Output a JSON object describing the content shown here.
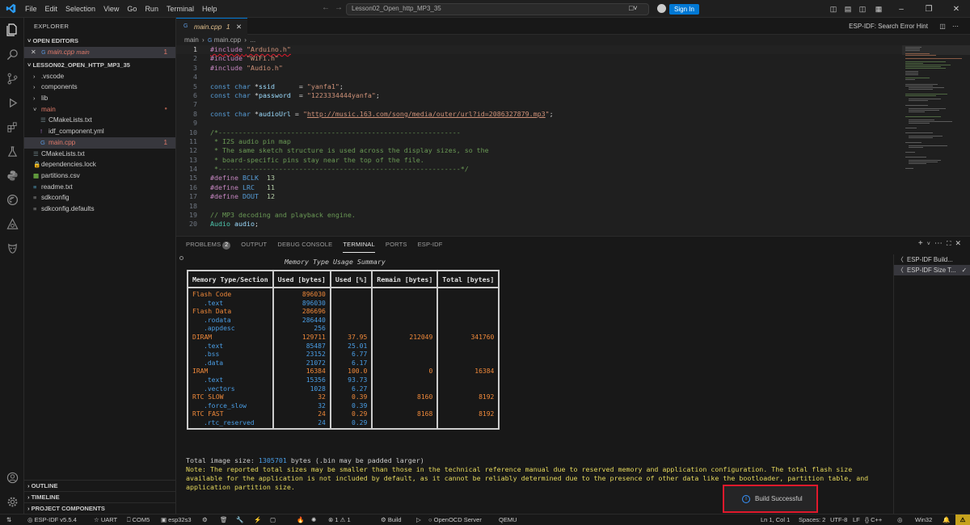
{
  "titlebar": {
    "menu": [
      "File",
      "Edit",
      "Selection",
      "View",
      "Go",
      "Run",
      "Terminal",
      "Help"
    ],
    "search": "Lesson02_Open_http_MP3_35",
    "signin": "Sign In"
  },
  "sidebar": {
    "header": "EXPLORER",
    "open_editors_title": "OPEN EDITORS",
    "open_editor": {
      "name": "main.cpp",
      "folder": "main",
      "problems": "1"
    },
    "project_title": "LESSON02_OPEN_HTTP_MP3_35",
    "tree": [
      {
        "label": ".vscode",
        "indent": 1,
        "kind": "folder",
        "mark": ""
      },
      {
        "label": "components",
        "indent": 1,
        "kind": "folder",
        "mark": ""
      },
      {
        "label": "lib",
        "indent": 1,
        "kind": "folder",
        "mark": ""
      },
      {
        "label": "main",
        "indent": 1,
        "kind": "folder-open",
        "mark": "dot"
      },
      {
        "label": "CMakeLists.txt",
        "indent": 2,
        "kind": "cmake",
        "mark": ""
      },
      {
        "label": "idf_component.yml",
        "indent": 2,
        "kind": "yml",
        "mark": ""
      },
      {
        "label": "main.cpp",
        "indent": 2,
        "kind": "cpp",
        "mark": "1"
      },
      {
        "label": "CMakeLists.txt",
        "indent": 1,
        "kind": "cmake",
        "mark": ""
      },
      {
        "label": "dependencies.lock",
        "indent": 1,
        "kind": "lock",
        "mark": ""
      },
      {
        "label": "partitions.csv",
        "indent": 1,
        "kind": "csv",
        "mark": ""
      },
      {
        "label": "readme.txt",
        "indent": 1,
        "kind": "txt",
        "mark": ""
      },
      {
        "label": "sdkconfig",
        "indent": 1,
        "kind": "gear",
        "mark": ""
      },
      {
        "label": "sdkconfig.defaults",
        "indent": 1,
        "kind": "gear",
        "mark": ""
      }
    ],
    "bottom_sections": [
      "OUTLINE",
      "TIMELINE",
      "PROJECT COMPONENTS"
    ]
  },
  "editor": {
    "tab": {
      "name": "main.cpp",
      "problems": "1"
    },
    "error_hint": "ESP-IDF: Search Error Hint",
    "breadcrumb": [
      "main",
      "main.cpp",
      "..."
    ],
    "code_lines": [
      {
        "n": "1",
        "text": "#include \"Arduino.h\""
      },
      {
        "n": "2",
        "text": "#include \"WiFi.h\""
      },
      {
        "n": "3",
        "text": "#include \"Audio.h\""
      },
      {
        "n": "4",
        "text": ""
      },
      {
        "n": "5",
        "text": "const char *ssid      = \"yanfa1\";"
      },
      {
        "n": "6",
        "text": "const char *password  = \"1223334444yanfa\";"
      },
      {
        "n": "7",
        "text": ""
      },
      {
        "n": "8",
        "text": "const char *audioUrl = \"http://music.163.com/song/media/outer/url?id=2086327879.mp3\";"
      },
      {
        "n": "9",
        "text": ""
      },
      {
        "n": "10",
        "text": "/*------------------------------------------------------------"
      },
      {
        "n": "11",
        "text": " * I2S audio pin map"
      },
      {
        "n": "12",
        "text": " * The same sketch structure is used across the display sizes, so the"
      },
      {
        "n": "13",
        "text": " * board-specific pins stay near the top of the file."
      },
      {
        "n": "14",
        "text": " *------------------------------------------------------------*/"
      },
      {
        "n": "15",
        "text": "#define BCLK  13"
      },
      {
        "n": "16",
        "text": "#define LRC   11"
      },
      {
        "n": "17",
        "text": "#define DOUT  12"
      },
      {
        "n": "18",
        "text": ""
      },
      {
        "n": "19",
        "text": "// MP3 decoding and playback engine."
      },
      {
        "n": "20",
        "text": "Audio audio;"
      }
    ]
  },
  "panel": {
    "tabs": [
      {
        "label": "PROBLEMS",
        "badge": "2"
      },
      {
        "label": "OUTPUT",
        "badge": ""
      },
      {
        "label": "DEBUG CONSOLE",
        "badge": ""
      },
      {
        "label": "TERMINAL",
        "badge": ""
      },
      {
        "label": "PORTS",
        "badge": ""
      },
      {
        "label": "ESP-IDF",
        "badge": ""
      }
    ],
    "terminal_list": [
      "ESP-IDF Build...",
      "ESP-IDF Size T..."
    ],
    "memory_title": "Memory Type Usage Summary",
    "memory_headers": [
      "Memory Type/Section",
      "Used [bytes]",
      "Used [%]",
      "Remain [bytes]",
      "Total [bytes]"
    ],
    "memory_rows": [
      {
        "name": "Flash Code",
        "sub": false,
        "used": "896030",
        "pct": "",
        "remain": "",
        "total": ""
      },
      {
        "name": ".text",
        "sub": true,
        "used": "896030",
        "pct": "",
        "remain": "",
        "total": ""
      },
      {
        "name": "Flash Data",
        "sub": false,
        "used": "286696",
        "pct": "",
        "remain": "",
        "total": ""
      },
      {
        "name": ".rodata",
        "sub": true,
        "used": "286440",
        "pct": "",
        "remain": "",
        "total": ""
      },
      {
        "name": ".appdesc",
        "sub": true,
        "used": "256",
        "pct": "",
        "remain": "",
        "total": ""
      },
      {
        "name": "DIRAM",
        "sub": false,
        "used": "129711",
        "pct": "37.95",
        "remain": "212049",
        "total": "341760"
      },
      {
        "name": ".text",
        "sub": true,
        "used": "85487",
        "pct": "25.01",
        "remain": "",
        "total": ""
      },
      {
        "name": ".bss",
        "sub": true,
        "used": "23152",
        "pct": "6.77",
        "remain": "",
        "total": ""
      },
      {
        "name": ".data",
        "sub": true,
        "used": "21072",
        "pct": "6.17",
        "remain": "",
        "total": ""
      },
      {
        "name": "IRAM",
        "sub": false,
        "used": "16384",
        "pct": "100.0",
        "remain": "0",
        "total": "16384"
      },
      {
        "name": ".text",
        "sub": true,
        "used": "15356",
        "pct": "93.73",
        "remain": "",
        "total": ""
      },
      {
        "name": ".vectors",
        "sub": true,
        "used": "1028",
        "pct": "6.27",
        "remain": "",
        "total": ""
      },
      {
        "name": "RTC SLOW",
        "sub": false,
        "used": "32",
        "pct": "0.39",
        "remain": "8160",
        "total": "8192"
      },
      {
        "name": ".force_slow",
        "sub": true,
        "used": "32",
        "pct": "0.39",
        "remain": "",
        "total": ""
      },
      {
        "name": "RTC FAST",
        "sub": false,
        "used": "24",
        "pct": "0.29",
        "remain": "8168",
        "total": "8192"
      },
      {
        "name": ".rtc_reserved",
        "sub": true,
        "used": "24",
        "pct": "0.29",
        "remain": "",
        "total": ""
      }
    ],
    "image_size_prefix": "Total image size: ",
    "image_size_value": "1305701",
    "image_size_suffix": " bytes (.bin may be padded larger)",
    "note": "Note: The reported total sizes may be smaller than those in the technical reference manual due to reserved memory and application configuration. The total flash size available for the application is not included by default, as it cannot be reliably determined due to the presence of other data like the bootloader, partition table, and application partition size."
  },
  "toast": "Build Successful",
  "statusbar": {
    "idf_version": "ESP-IDF v5.5.4",
    "flash_method": "UART",
    "port": "COM5",
    "target": "esp32s3",
    "errors": "1",
    "warnings": "1",
    "build": "Build",
    "openocd": "OpenOCD Server",
    "qemu": "QEMU",
    "cursor": "Ln 1, Col 1",
    "spaces": "Spaces: 2",
    "encoding": "UTF-8",
    "eol": "LF",
    "language": "C++",
    "platform": "Win32"
  },
  "colors": {
    "accent": "#0078d4",
    "warning_text": "#e5d85c",
    "number_orange": "#f0893a",
    "number_blue": "#4a9ee6",
    "toast_outline": "#e0192c"
  }
}
